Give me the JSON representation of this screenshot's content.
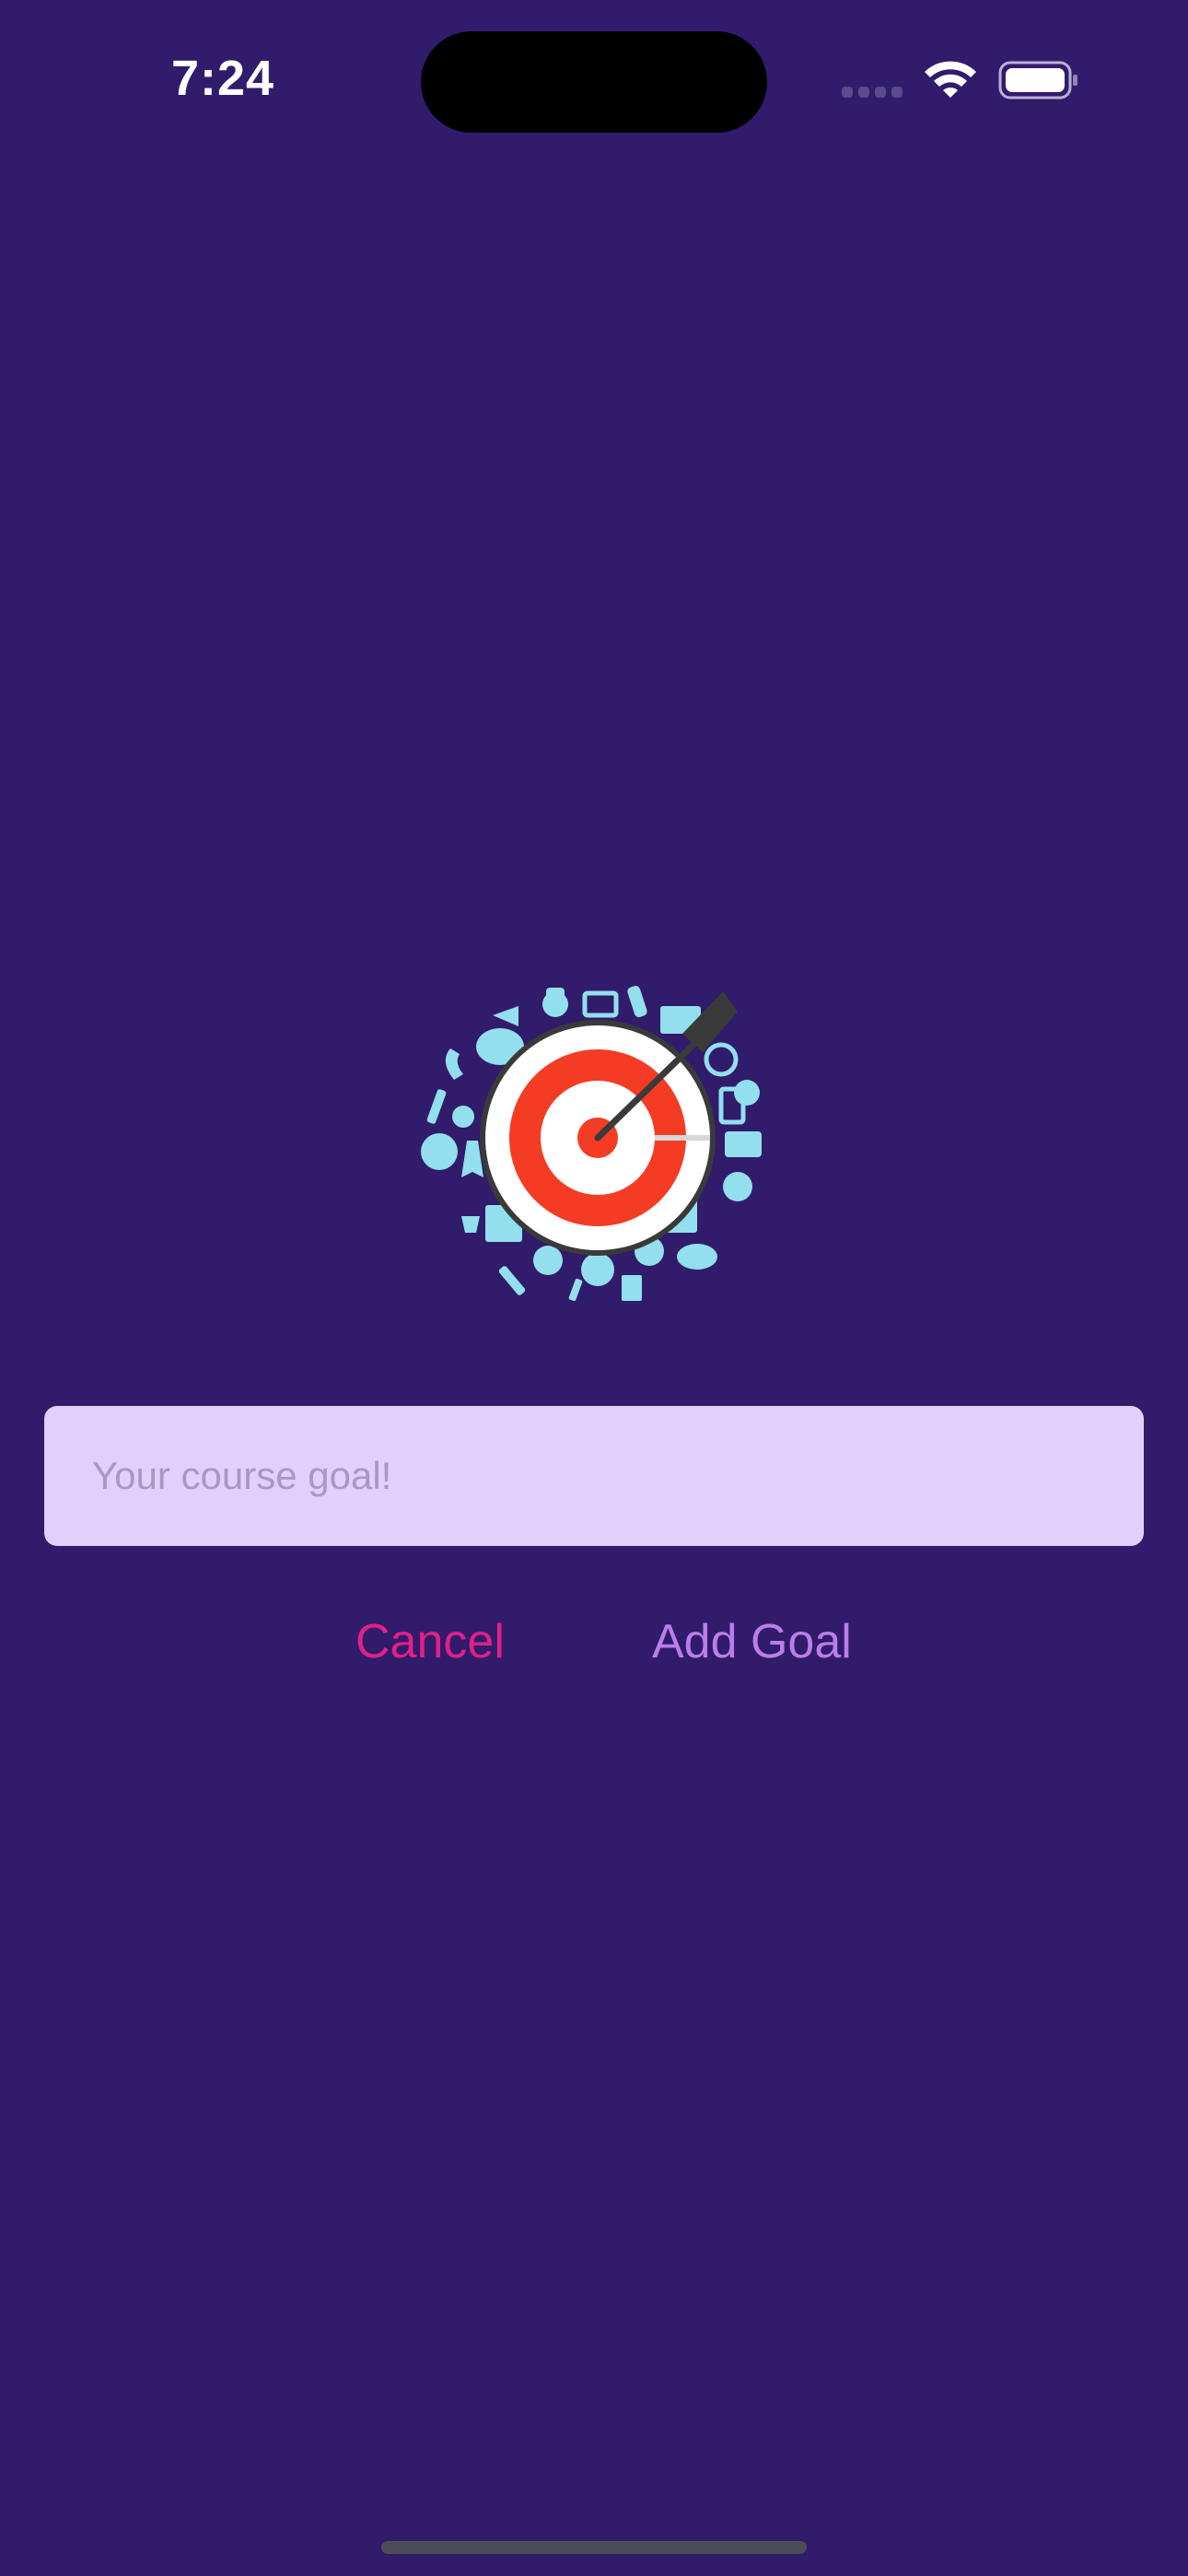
{
  "status_bar": {
    "time": "7:24"
  },
  "goal_image": {
    "icon": "target-with-arrow-icon",
    "colors": {
      "ring_outer": "#ffffff",
      "ring_red": "#f43c24",
      "arrow": "#3a3a3a",
      "icons": "#93dfee"
    }
  },
  "goal_input": {
    "value": "",
    "placeholder": "Your course goal!"
  },
  "buttons": {
    "cancel_label": "Cancel",
    "add_label": "Add Goal"
  },
  "colors": {
    "background": "#311b6b",
    "input_background": "#e1cffc",
    "cancel": "#e0208a",
    "add_goal": "#b97ee8"
  }
}
